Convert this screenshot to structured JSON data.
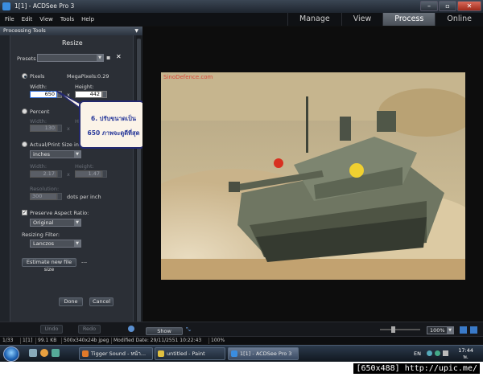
{
  "window": {
    "title": "1[1] - ACDSee Pro 3"
  },
  "menu": [
    "File",
    "Edit",
    "View",
    "Tools",
    "Help"
  ],
  "modes": [
    {
      "label": "Manage",
      "active": false
    },
    {
      "label": "View",
      "active": false
    },
    {
      "label": "Process",
      "active": true
    },
    {
      "label": "Online",
      "active": false
    }
  ],
  "panel": {
    "header": "Processing Tools",
    "title": "Resize"
  },
  "resize": {
    "presets_label": "Presets",
    "pixels_label": "Pixels",
    "megapixels_label": "MegaPixels:",
    "megapixels_value": "0.29",
    "width_label": "Width:",
    "height_label": "Height:",
    "width_value": "650",
    "height_value": "442",
    "times": "x",
    "percent_label": "Percent",
    "percent_width_value": "130",
    "percent_height_value": "130",
    "print_label": "Actual/Print Size in:",
    "print_unit": "inches",
    "print_width_value": "2.17",
    "print_height_value": "1.47",
    "resolution_label": "Resolution:",
    "resolution_value": "300",
    "resolution_unit": "dots per inch",
    "preserve_label": "Preserve Aspect Ratio:",
    "preserve_value": "Original",
    "filter_label": "Resizing Filter:",
    "filter_value": "Lanczos",
    "estimate_label": "Estimate new file size",
    "estimate_value": "---",
    "done_label": "Done",
    "cancel_label": "Cancel",
    "undo_label": "Undo",
    "redo_label": "Redo"
  },
  "callout": {
    "line1": "6. ปรับขนาดเป็น",
    "line2": "650 ภาพจะดูดีที่สุด"
  },
  "viewer": {
    "watermark": "SinoDefence.com",
    "show_previous": "Show Previous",
    "zoom": "100%"
  },
  "status": [
    "1/33",
    "1[1]",
    "99.1 KB",
    "500x340x24b jpeg",
    "Modified Date: 29/11/2551 10:22:43",
    "100%"
  ],
  "taskbar": {
    "tasks": [
      {
        "label": "Tigger Sound - หน้า...",
        "active": false,
        "color": "#e07a2a"
      },
      {
        "label": "untitled - Paint",
        "active": false,
        "color": "#e0c040"
      },
      {
        "label": "1[1] - ACDSee Pro 3",
        "active": true,
        "color": "#3a8de0"
      }
    ],
    "lang": "EN",
    "time": "17:44",
    "day": "พ."
  },
  "footer": "[650x488] http://upic.me/"
}
